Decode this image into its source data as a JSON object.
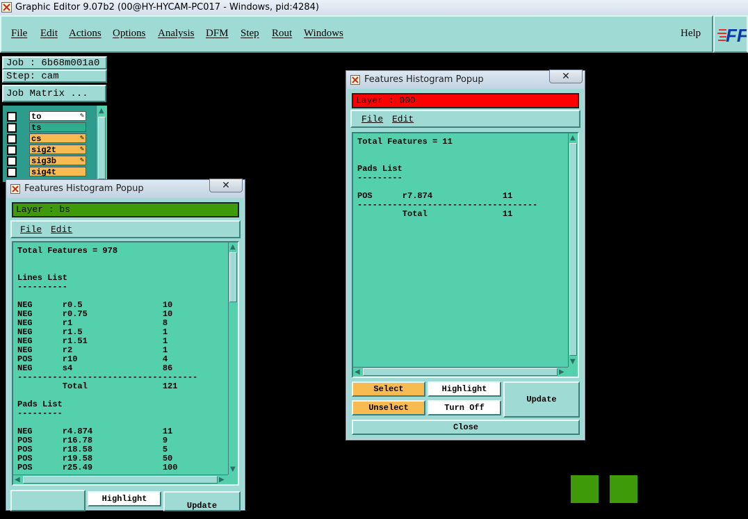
{
  "window": {
    "title": "Graphic Editor 9.07b2 (00@HY-HYCAM-PC017 - Windows, pid:4284)"
  },
  "menubar": {
    "items": [
      "File",
      "Edit",
      "Actions",
      "Options",
      "Analysis",
      "DFM",
      "Step",
      "Rout",
      "Windows"
    ],
    "help": "Help",
    "logo": "FF"
  },
  "left_panel": {
    "job": "Job : 6b68m001a0",
    "step": "Step: cam",
    "job_matrix": "Job Matrix ...",
    "layers": [
      {
        "name": "to",
        "mark": "✎",
        "color": "#ffffff"
      },
      {
        "name": "ts",
        "mark": "",
        "color": "#2eae8e"
      },
      {
        "name": "cs",
        "mark": "✎",
        "color": "#f8bb52"
      },
      {
        "name": "sig2t",
        "mark": "✎",
        "color": "#f8bb52"
      },
      {
        "name": "sig3b",
        "mark": "✎",
        "color": "#f8bb52"
      },
      {
        "name": "sig4t",
        "mark": "",
        "color": "#f8bb52"
      }
    ]
  },
  "popup_left": {
    "title": "Features Histogram Popup",
    "close_glyph": "✕",
    "layer_label": "Layer :  bs",
    "layer_color": "#3f9a0a",
    "menu": [
      "File",
      "Edit"
    ],
    "content": "Total Features = 978\n\n\nLines List\n----------\n\nNEG      r0.5                10\nNEG      r0.75               10\nNEG      r1                  8\nNEG      r1.5                1\nNEG      r1.51               1\nNEG      r2                  1\nPOS      r10                 4\nNEG      s4                  86\n------------------------------------\n         Total               121\n\nPads List\n---------\n\nNEG      r4.874              11\nPOS      r16.78              9\nPOS      r18.58              5\nPOS      r19.58              50\nPOS      r25.49              100",
    "buttons": {
      "highlight": "Highlight",
      "update": "Update"
    }
  },
  "popup_right": {
    "title": "Features Histogram Popup",
    "close_glyph": "✕",
    "layer_label": "Layer :  000",
    "layer_color": "#ff0000",
    "menu": [
      "File",
      "Edit"
    ],
    "content": "Total Features = 11\n\n\nPads List\n---------\n\nPOS      r7.874              11\n------------------------------------\n         Total               11",
    "buttons": {
      "select": "Select",
      "highlight": "Highlight",
      "update": "Update",
      "unselect": "Unselect",
      "turn_off": "Turn Off",
      "close": "Close"
    }
  },
  "colors": {
    "panel": "#9fdad5",
    "list_bg": "#55d0ad",
    "orange": "#f8bb52",
    "square_green": "#3f9a0a"
  }
}
